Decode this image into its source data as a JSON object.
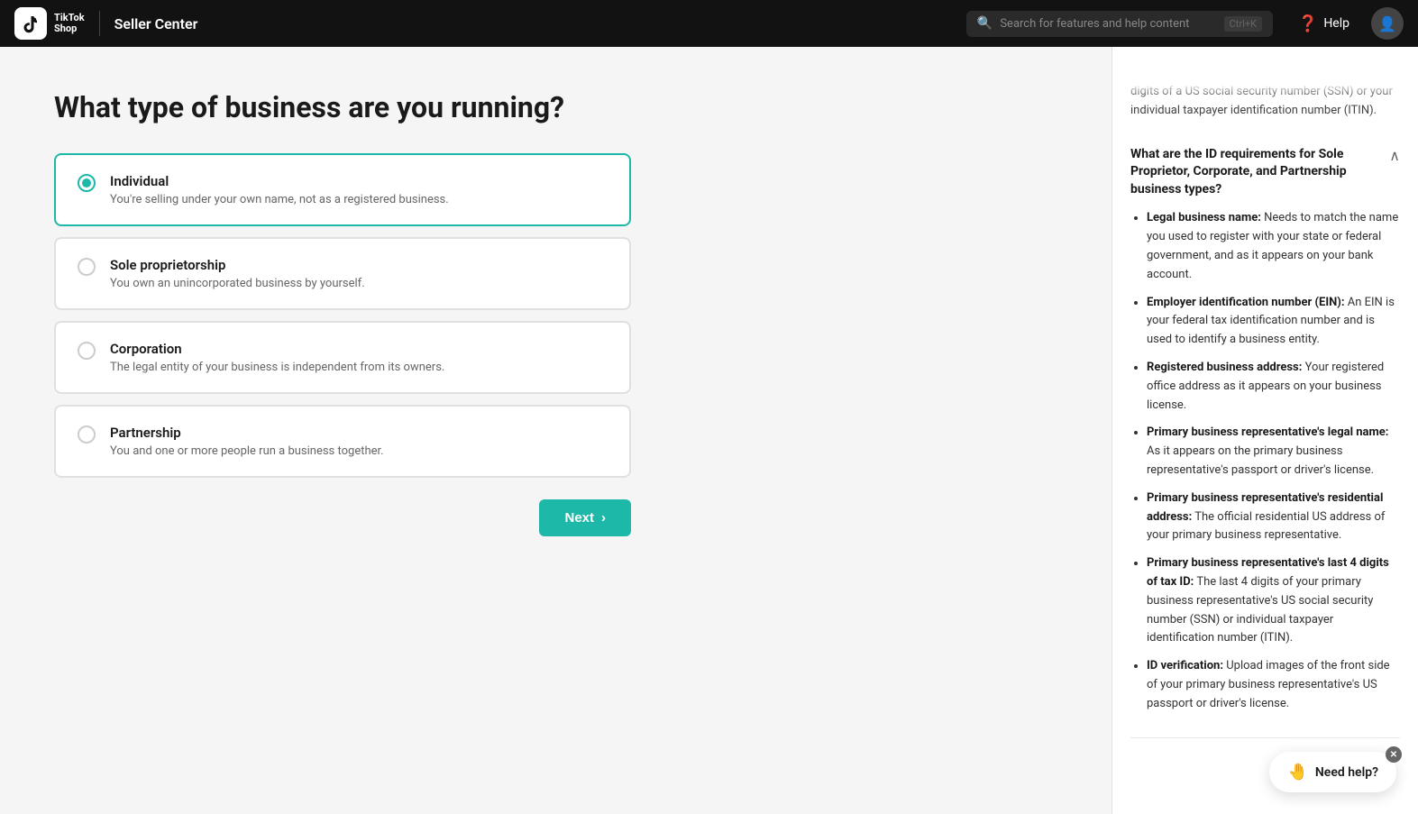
{
  "header": {
    "logo_text": "TikTok\nShop",
    "divider": "|",
    "seller_center": "Seller Center",
    "search_placeholder": "Search for features and help content",
    "search_shortcut": "Ctrl+K",
    "help_label": "Help"
  },
  "page": {
    "title": "What type of business are you running?"
  },
  "business_types": [
    {
      "id": "individual",
      "name": "Individual",
      "description": "You're selling under your own name, not as a registered business.",
      "selected": true
    },
    {
      "id": "sole-proprietorship",
      "name": "Sole proprietorship",
      "description": "You own an unincorporated business by yourself.",
      "selected": false
    },
    {
      "id": "corporation",
      "name": "Corporation",
      "description": "The legal entity of your business is independent from its owners.",
      "selected": false
    },
    {
      "id": "partnership",
      "name": "Partnership",
      "description": "You and one or more people run a business together.",
      "selected": false
    }
  ],
  "next_button": "Next",
  "sidebar": {
    "fade_text": "digits of a US social security number (SSN) or your individual taxpayer identification number (ITIN).",
    "section_title": "What are the ID requirements for Sole Proprietor, Corporate, and Partnership business types?",
    "items": [
      {
        "label": "Legal business name:",
        "text": "Needs to match the name you used to register with your state or federal government, and as it appears on your bank account."
      },
      {
        "label": "Employer identification number (EIN):",
        "text": "An EIN is your federal tax identification number and is used to identify a business entity."
      },
      {
        "label": "Registered business address:",
        "text": "Your registered office address as it appears on your business license."
      },
      {
        "label": "Primary business representative's legal name:",
        "text": "As it appears on the primary business representative's passport or driver's license."
      },
      {
        "label": "Primary business representative's residential address:",
        "text": "The official residential US address of your primary business representative."
      },
      {
        "label": "Primary business representative's last 4 digits of tax ID:",
        "text": "The last 4 digits of your primary business representative's US social security number (SSN) or individual taxpayer identification number (ITIN)."
      },
      {
        "label": "ID verification:",
        "text": "Upload images of the front side of your primary business representative's US passport or driver's license."
      }
    ]
  },
  "need_help": {
    "label": "Need help?"
  }
}
